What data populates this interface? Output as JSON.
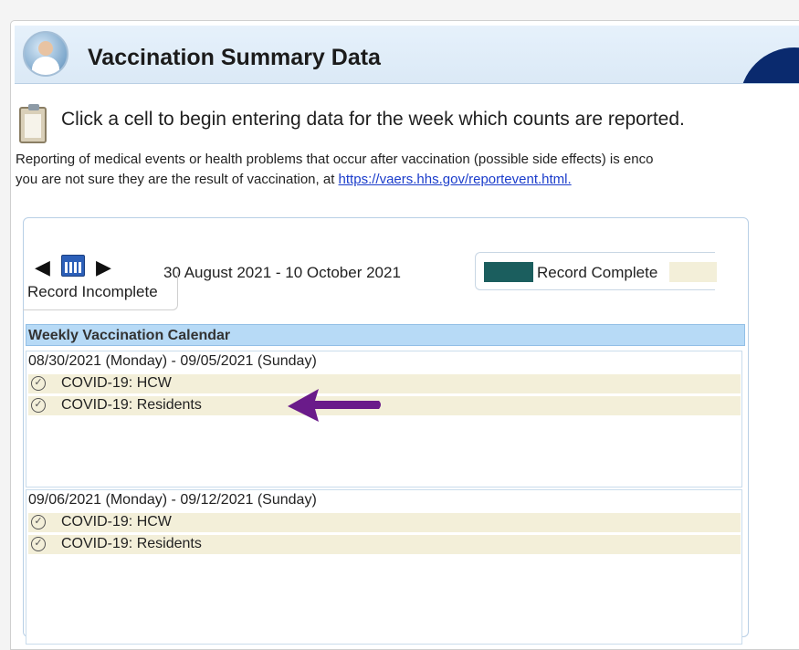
{
  "header": {
    "title": "Vaccination Summary Data"
  },
  "instruction": "Click a cell to begin entering data for the week which counts are reported.",
  "vaers": {
    "line1": "Reporting of medical events or health problems that occur after vaccination (possible side effects) is enco",
    "line2_prefix": "you are not sure they are the result of vaccination, at ",
    "link": "https://vaers.hhs.gov/reportevent.html."
  },
  "calendar": {
    "date_range": "30 August 2021 - 10 October 2021",
    "prev_label": "◀",
    "next_label": "▶",
    "legend": {
      "complete": "Record Complete",
      "incomplete": "Record Incomplete",
      "complete_color": "#1b5e5e",
      "incomplete_color": "#f3efd9"
    },
    "weekly_header": "Weekly Vaccination Calendar",
    "weeks": [
      {
        "label": "08/30/2021 (Monday) - 09/05/2021 (Sunday)",
        "items": [
          "COVID-19: HCW",
          "COVID-19: Residents"
        ]
      },
      {
        "label": "09/06/2021 (Monday) - 09/12/2021 (Sunday)",
        "items": [
          "COVID-19: HCW",
          "COVID-19: Residents"
        ]
      }
    ]
  },
  "icons": {
    "status": "check-circle-icon",
    "annotation": "purple-arrow-icon",
    "annotation_color": "#6a1b8a"
  }
}
